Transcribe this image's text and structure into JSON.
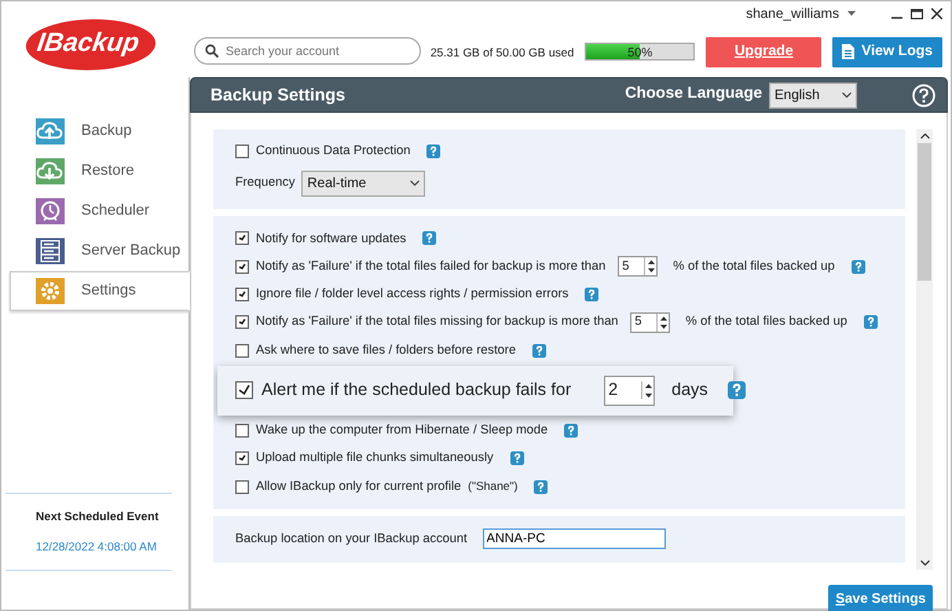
{
  "window": {
    "user": "shane_williams"
  },
  "logo": {
    "text": "IBackup"
  },
  "search": {
    "placeholder": "Search your account"
  },
  "storage": {
    "text": "25.31 GB of 50.00 GB used",
    "level": 0.5,
    "reading": "50%"
  },
  "buttons": [
    {
      "label": "Upgrade",
      "kind": "upgrade"
    },
    {
      "label": "View Logs",
      "kind": "logs"
    }
  ],
  "sidebar": {
    "items": [
      {
        "label": "Backup",
        "color": "#3a9ec6",
        "selected": false
      },
      {
        "label": "Restore",
        "color": "#5fa86a",
        "selected": false
      },
      {
        "label": "Scheduler",
        "color": "#9b6aae",
        "selected": false
      },
      {
        "label": "Server Backup",
        "color": "#4a5e8e",
        "selected": false
      },
      {
        "label": "Settings",
        "color": "#e0a02a",
        "selected": true
      }
    ]
  },
  "next_event": {
    "label": "Next Scheduled Event",
    "value": "12/28/2022 4:08:00 AM"
  },
  "panel": {
    "title": "Backup Settings",
    "language_label": "Choose Language",
    "language": "English"
  },
  "cdp": {
    "label": "Continuous Data Protection",
    "checked": false,
    "frequency_label": "Frequency",
    "frequency": "Real-time"
  },
  "options": [
    {
      "label": "Notify for software updates",
      "checked": true
    },
    {
      "label": "Notify as 'Failure' if the total files failed for backup is more than",
      "checked": true,
      "value": "5",
      "suffix": "% of the total files backed up"
    },
    {
      "label": "Ignore file / folder level access rights / permission errors",
      "checked": true
    },
    {
      "label": "Notify as 'Failure' if the total files missing for backup is more than",
      "checked": true,
      "value": "5",
      "suffix": "% of the total files backed up"
    },
    {
      "label": "Ask where to save files / folders before restore",
      "checked": false
    },
    {
      "kind": "covered"
    },
    {
      "label": "Wake up the computer from Hibernate / Sleep mode",
      "checked": false
    },
    {
      "label": "Upload multiple file chunks simultaneously",
      "checked": true
    },
    {
      "label": "Allow IBackup only for current profile",
      "note": "(\"Shane\")",
      "checked": false
    }
  ],
  "location": {
    "label": "Backup location on your IBackup account",
    "value": "ANNA-PC"
  },
  "popup": {
    "checked": true,
    "label": "Alert me if the scheduled backup fails for",
    "value": "2",
    "suffix": "days"
  },
  "save_button": "Save Settings"
}
